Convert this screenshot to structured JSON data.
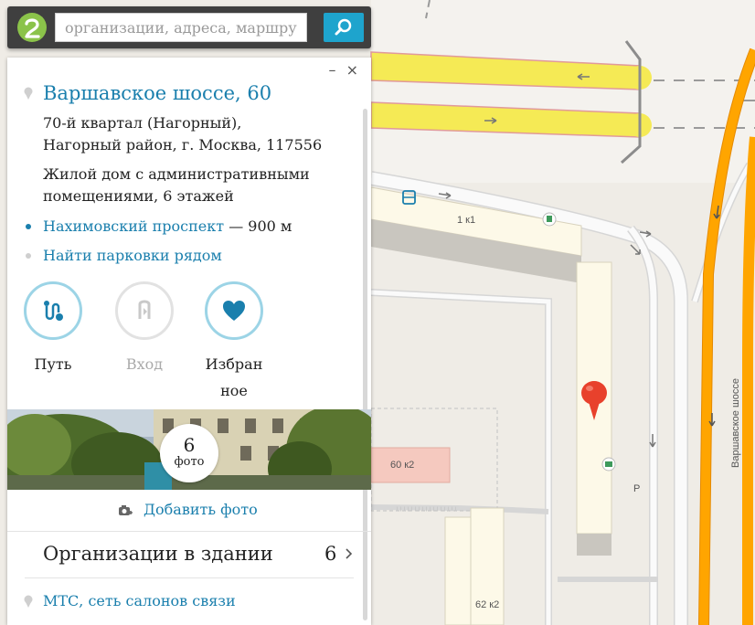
{
  "search": {
    "placeholder": "организации, адреса, маршру"
  },
  "map": {
    "street_label": "Варшавское шоссе",
    "buildings": [
      "1 к1",
      "60 к2",
      "62 к2"
    ],
    "parking_mark": "P",
    "colors": {
      "background": "#efece6",
      "highway": "#ffa500",
      "main_road": "#f5ea55",
      "road_edge": "#e19a9a",
      "building": "#fdf9e8",
      "selected_building": "#f5c9bf",
      "marker": "#e8412c"
    }
  },
  "card": {
    "controls": {
      "minimize": "–",
      "close": "×"
    },
    "address": "Варшавское шоссе, 60",
    "address_details": [
      "70-й квартал (Нагорный),",
      "Нагорный район, г. Москва, 117556"
    ],
    "description": [
      "Жилой дом с административными",
      "помещениями, 6 этажей"
    ],
    "metro": {
      "name": "Нахимовский проспект",
      "distance": "— 900 м"
    },
    "parking_link": "Найти парковки рядом",
    "actions": [
      {
        "label": "Путь",
        "icon": "route-icon",
        "enabled": true
      },
      {
        "label": "Вход",
        "icon": "entrance-icon",
        "enabled": false
      },
      {
        "label_line1": "Избран",
        "label_line2": "ное",
        "icon": "heart-icon",
        "enabled": true
      }
    ],
    "photos": {
      "count": "6",
      "word": "фото"
    },
    "add_photo": "Добавить фото",
    "organizations": {
      "title": "Организации в здании",
      "count": "6"
    },
    "org_items": [
      "МТС, сеть салонов связи"
    ],
    "accent_color": "#1a7fad"
  }
}
